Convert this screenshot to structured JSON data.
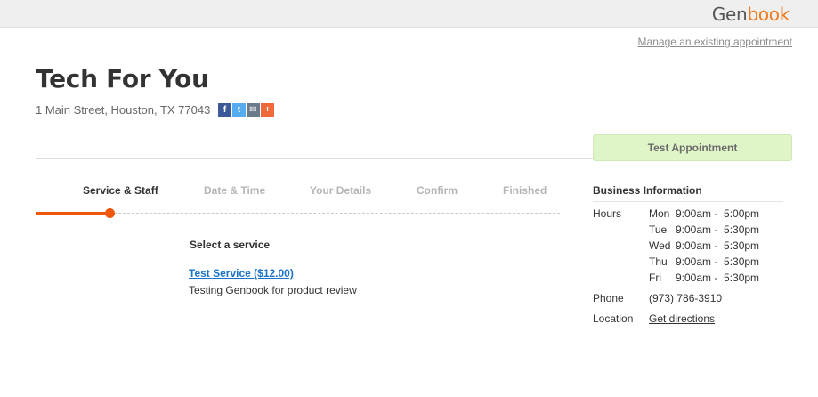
{
  "brand": {
    "part1": "Gen",
    "part2": "book",
    "accent": "#f07a1c"
  },
  "header": {
    "manage_link": "Manage an existing appointment"
  },
  "business": {
    "name": "Tech For You",
    "address": "1 Main Street, Houston, TX 77043"
  },
  "social": {
    "facebook": {
      "icon": "facebook-icon",
      "glyph": "f",
      "color": "#3b5998"
    },
    "twitter": {
      "icon": "twitter-icon",
      "glyph": "t",
      "color": "#55acee"
    },
    "email": {
      "icon": "email-icon",
      "glyph": "✉",
      "color": "#6b7b8a"
    },
    "share": {
      "icon": "plus-icon",
      "glyph": "+",
      "color": "#ee6a3a"
    }
  },
  "appointment_tab": {
    "label": "Test Appointment",
    "color": "#dff5c8"
  },
  "steps": [
    {
      "label": "Service & Staff"
    },
    {
      "label": "Date & Time"
    },
    {
      "label": "Your Details"
    },
    {
      "label": "Confirm"
    },
    {
      "label": "Finished"
    }
  ],
  "progress": {
    "current_step": 1,
    "total_steps": 5,
    "color": "#f0570a"
  },
  "service_section": {
    "heading": "Select a service",
    "services": [
      {
        "name": "Test Service ($12.00)",
        "description": "Testing Genbook for product review"
      }
    ]
  },
  "info": {
    "title": "Business Information",
    "hours_label": "Hours",
    "hours": [
      {
        "day": "Mon",
        "time": "9:00am -  5:00pm"
      },
      {
        "day": "Tue",
        "time": "9:00am -  5:30pm"
      },
      {
        "day": "Wed",
        "time": "9:00am -  5:30pm"
      },
      {
        "day": "Thu",
        "time": "9:00am -  5:30pm"
      },
      {
        "day": "Fri",
        "time": "9:00am -  5:30pm"
      }
    ],
    "phone_label": "Phone",
    "phone": "(973) 786-3910",
    "location_label": "Location",
    "location_link": "Get directions"
  }
}
